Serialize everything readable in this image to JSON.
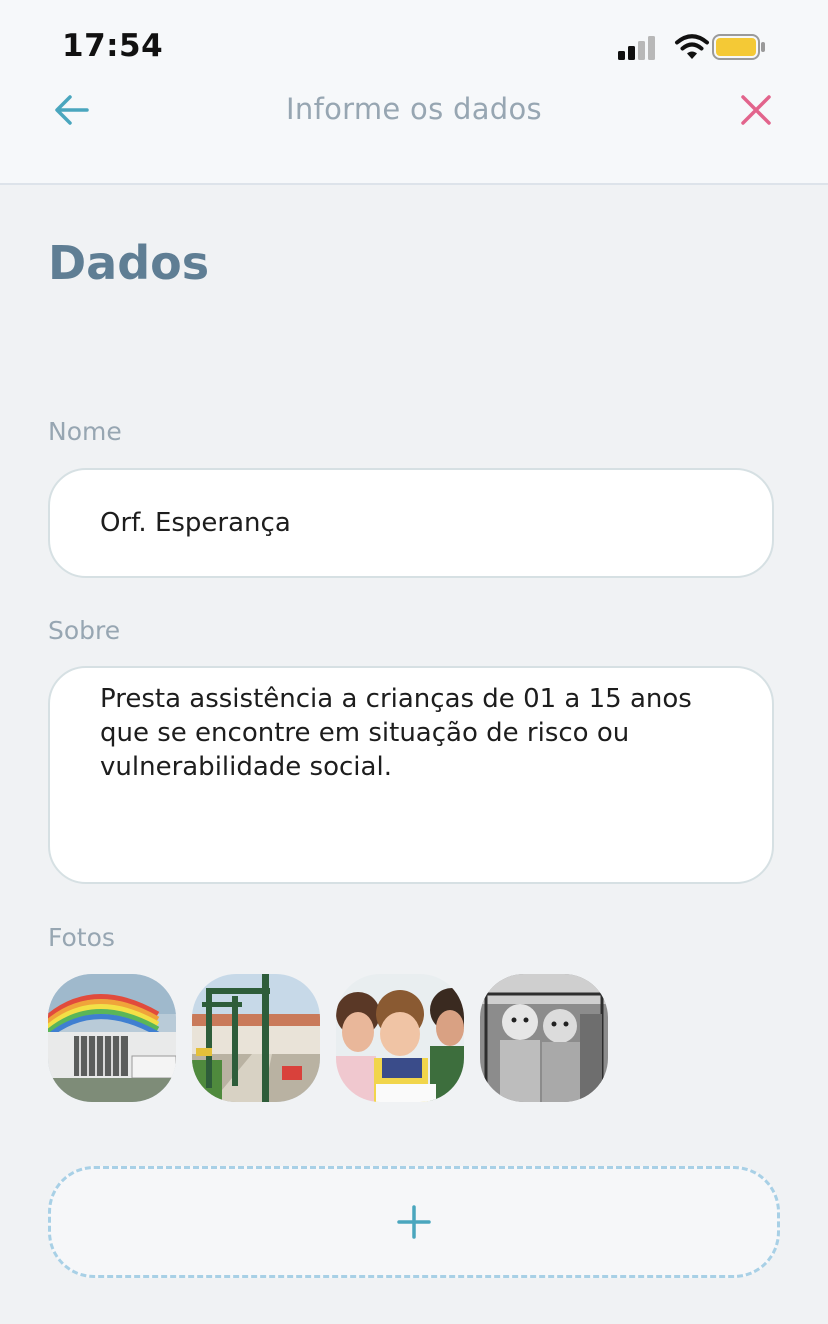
{
  "status_bar": {
    "time": "17:54",
    "icons": [
      "cellular-signal-icon",
      "wifi-icon",
      "battery-icon"
    ]
  },
  "nav": {
    "back_icon": "arrow-left-icon",
    "title": "Informe os dados",
    "close_icon": "close-icon"
  },
  "section": {
    "title": "Dados"
  },
  "form": {
    "name": {
      "label": "Nome",
      "value": "Orf. Esperança"
    },
    "about": {
      "label": "Sobre",
      "value": "Presta assistência a crianças de 01 a 15 anos\nque se encontre em situação de risco ou\nvulnerabilidade social."
    },
    "photos": {
      "label": "Fotos",
      "items": [
        "photo-building-rainbow",
        "photo-playground",
        "photo-children-studying",
        "photo-babies"
      ]
    },
    "add_button": {
      "icon": "plus-icon"
    }
  },
  "colors": {
    "accent": "#4aa6be",
    "close": "#e2648c",
    "title": "#5f7e94",
    "label": "#97a6b2",
    "background": "#f0f2f4"
  }
}
